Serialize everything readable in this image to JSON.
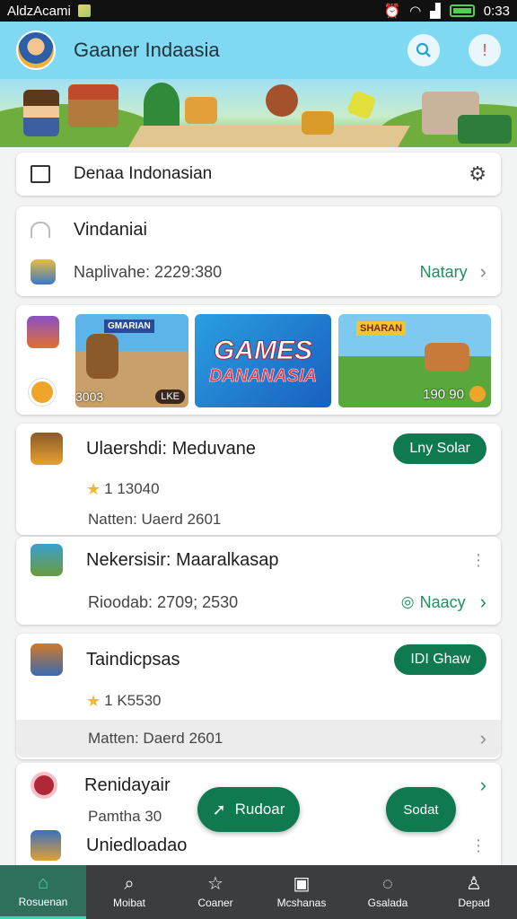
{
  "status_bar": {
    "carrier": "AldzAcami",
    "time": "0:33"
  },
  "app_bar": {
    "title": "Gaaner Indaasia",
    "search_icon": "search-icon",
    "alert_icon": "alert-icon"
  },
  "category_card": {
    "label": "Denaa Indonasian"
  },
  "summary_card": {
    "title": "Vindaniai",
    "subtitle": "Naplivahe: 2229:380",
    "link": "Natary"
  },
  "featured": {
    "tile1_title": "GMARIAN",
    "tile1_price": "3003",
    "tile1_badge": "LKE",
    "tile2_title": "GAMES",
    "tile2_subtitle": "DANANASIA",
    "tile3_title": "SHARAN",
    "tile3_value": "190 90"
  },
  "list": [
    {
      "title": "Ulaershdi: Meduvane",
      "rating": "1 13040",
      "meta": "Natten: Uaerd 2601",
      "button": "Lny Solar"
    },
    {
      "title": "Nekersisir: Maaralkasap",
      "meta": "Rioodab: 2709; 2530",
      "link": "Naacy"
    },
    {
      "title": "Taindicpsas",
      "rating": "1 K5530",
      "meta": "Matten: Daerd 2601",
      "button": "IDI Ghaw"
    },
    {
      "title": "Renidayair",
      "meta": "Pamtha 30"
    },
    {
      "title": "Uniedloadao"
    }
  ],
  "fabs": {
    "left": "Rudoar",
    "right": "Sodat"
  },
  "bottom_nav": [
    "Rosuenan",
    "Moibat",
    "Coaner",
    "Mcshanas",
    "Gsalada",
    "Depad"
  ],
  "colors": {
    "accent": "#0f7a4f",
    "appbar": "#7fd9f3"
  }
}
